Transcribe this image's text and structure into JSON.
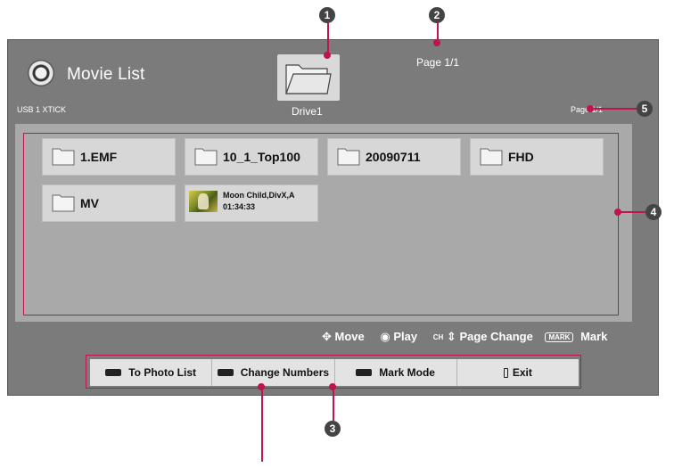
{
  "header": {
    "title": "Movie List",
    "usb_label": "USB 1 XTICK",
    "drive_label": "Drive1",
    "page_top": "Page 1/1",
    "page_right": "Page 1/1"
  },
  "folders": [
    {
      "label": "1.EMF"
    },
    {
      "label": "10_1_Top100"
    },
    {
      "label": "20090711"
    },
    {
      "label": "FHD"
    },
    {
      "label": "MV"
    }
  ],
  "movie": {
    "name": "Moon Child,DivX,A",
    "duration": "01:34:33"
  },
  "legend": {
    "move": "Move",
    "play": "Play",
    "ch_badge": "CH",
    "page_change": "Page Change",
    "mark_badge": "MARK",
    "mark": "Mark"
  },
  "buttons": [
    {
      "label": "To Photo List"
    },
    {
      "label": "Change Numbers"
    },
    {
      "label": "Mark Mode"
    },
    {
      "label": "Exit"
    }
  ],
  "annotations": [
    "1",
    "2",
    "3",
    "4",
    "5"
  ],
  "colors": {
    "annotation": "#c0134f",
    "screen_bg": "#7b7b7b",
    "panel_bg": "#a9a9a9",
    "item_bg": "#d7d7d7"
  }
}
